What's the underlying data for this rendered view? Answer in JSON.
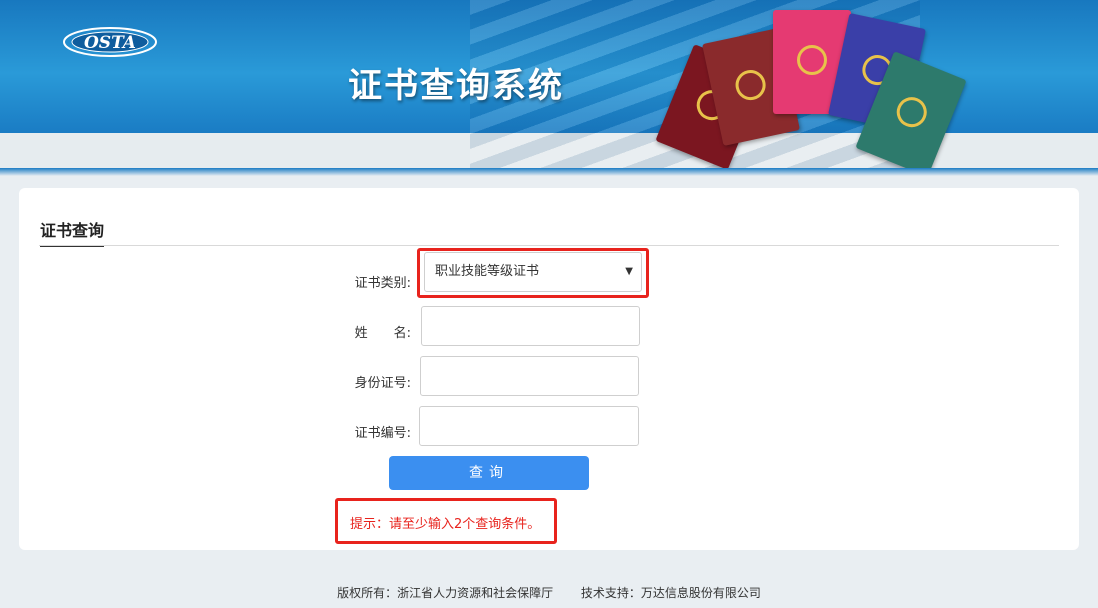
{
  "header": {
    "logo_text": "OSTA",
    "title": "证书查询系统"
  },
  "form": {
    "section_title": "证书查询",
    "cert_type_label": "证书类别:",
    "cert_type_value": "职业技能等级证书",
    "name_label": "姓　　名:",
    "id_label": "身份证号:",
    "cert_no_label": "证书编号:",
    "name_value": "",
    "id_value": "",
    "cert_no_value": "",
    "submit_label": "查询",
    "hint": "提示：请至少输入2个查询条件。"
  },
  "footer": {
    "copyright": "版权所有：浙江省人力资源和社会保障厅",
    "tech_support": "技术支持：万达信息股份有限公司"
  },
  "colors": {
    "accent": "#3b8ff0",
    "highlight": "#e8231d",
    "banner": "#1e82c8"
  }
}
